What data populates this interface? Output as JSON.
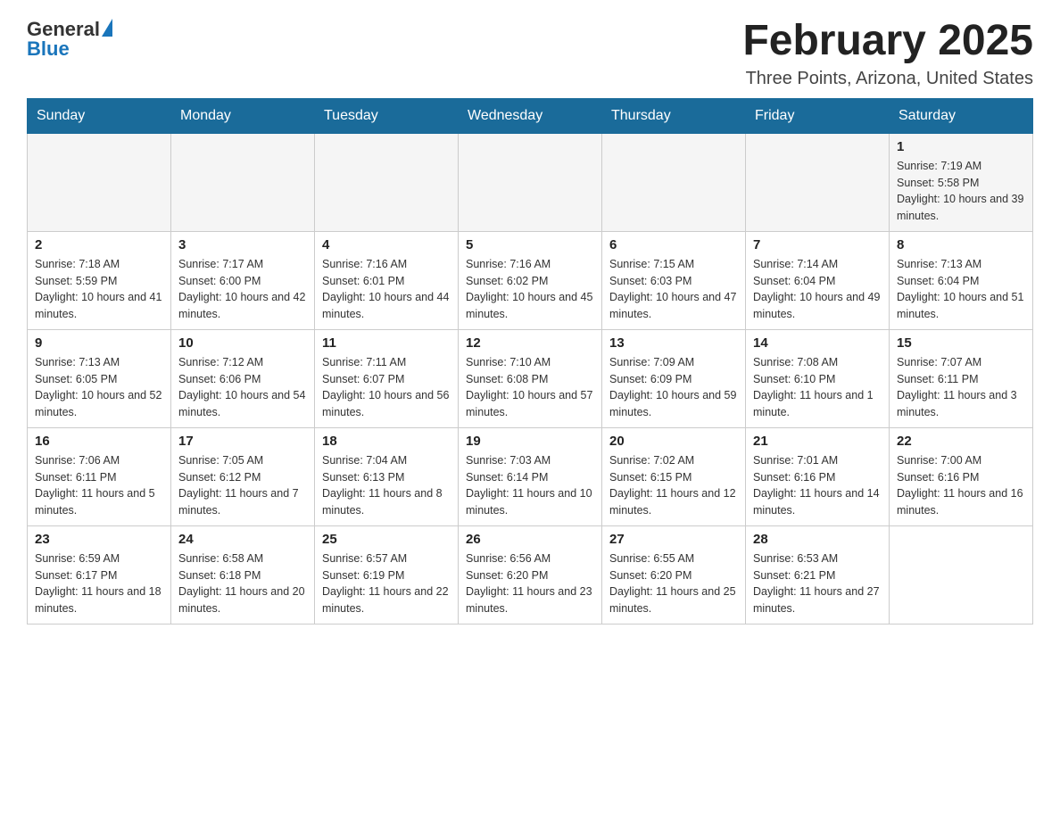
{
  "header": {
    "logo_general": "General",
    "logo_blue": "Blue",
    "month_title": "February 2025",
    "location": "Three Points, Arizona, United States"
  },
  "weekdays": [
    "Sunday",
    "Monday",
    "Tuesday",
    "Wednesday",
    "Thursday",
    "Friday",
    "Saturday"
  ],
  "weeks": [
    {
      "days": [
        {
          "num": "",
          "info": ""
        },
        {
          "num": "",
          "info": ""
        },
        {
          "num": "",
          "info": ""
        },
        {
          "num": "",
          "info": ""
        },
        {
          "num": "",
          "info": ""
        },
        {
          "num": "",
          "info": ""
        },
        {
          "num": "1",
          "info": "Sunrise: 7:19 AM\nSunset: 5:58 PM\nDaylight: 10 hours and 39 minutes."
        }
      ]
    },
    {
      "days": [
        {
          "num": "2",
          "info": "Sunrise: 7:18 AM\nSunset: 5:59 PM\nDaylight: 10 hours and 41 minutes."
        },
        {
          "num": "3",
          "info": "Sunrise: 7:17 AM\nSunset: 6:00 PM\nDaylight: 10 hours and 42 minutes."
        },
        {
          "num": "4",
          "info": "Sunrise: 7:16 AM\nSunset: 6:01 PM\nDaylight: 10 hours and 44 minutes."
        },
        {
          "num": "5",
          "info": "Sunrise: 7:16 AM\nSunset: 6:02 PM\nDaylight: 10 hours and 45 minutes."
        },
        {
          "num": "6",
          "info": "Sunrise: 7:15 AM\nSunset: 6:03 PM\nDaylight: 10 hours and 47 minutes."
        },
        {
          "num": "7",
          "info": "Sunrise: 7:14 AM\nSunset: 6:04 PM\nDaylight: 10 hours and 49 minutes."
        },
        {
          "num": "8",
          "info": "Sunrise: 7:13 AM\nSunset: 6:04 PM\nDaylight: 10 hours and 51 minutes."
        }
      ]
    },
    {
      "days": [
        {
          "num": "9",
          "info": "Sunrise: 7:13 AM\nSunset: 6:05 PM\nDaylight: 10 hours and 52 minutes."
        },
        {
          "num": "10",
          "info": "Sunrise: 7:12 AM\nSunset: 6:06 PM\nDaylight: 10 hours and 54 minutes."
        },
        {
          "num": "11",
          "info": "Sunrise: 7:11 AM\nSunset: 6:07 PM\nDaylight: 10 hours and 56 minutes."
        },
        {
          "num": "12",
          "info": "Sunrise: 7:10 AM\nSunset: 6:08 PM\nDaylight: 10 hours and 57 minutes."
        },
        {
          "num": "13",
          "info": "Sunrise: 7:09 AM\nSunset: 6:09 PM\nDaylight: 10 hours and 59 minutes."
        },
        {
          "num": "14",
          "info": "Sunrise: 7:08 AM\nSunset: 6:10 PM\nDaylight: 11 hours and 1 minute."
        },
        {
          "num": "15",
          "info": "Sunrise: 7:07 AM\nSunset: 6:11 PM\nDaylight: 11 hours and 3 minutes."
        }
      ]
    },
    {
      "days": [
        {
          "num": "16",
          "info": "Sunrise: 7:06 AM\nSunset: 6:11 PM\nDaylight: 11 hours and 5 minutes."
        },
        {
          "num": "17",
          "info": "Sunrise: 7:05 AM\nSunset: 6:12 PM\nDaylight: 11 hours and 7 minutes."
        },
        {
          "num": "18",
          "info": "Sunrise: 7:04 AM\nSunset: 6:13 PM\nDaylight: 11 hours and 8 minutes."
        },
        {
          "num": "19",
          "info": "Sunrise: 7:03 AM\nSunset: 6:14 PM\nDaylight: 11 hours and 10 minutes."
        },
        {
          "num": "20",
          "info": "Sunrise: 7:02 AM\nSunset: 6:15 PM\nDaylight: 11 hours and 12 minutes."
        },
        {
          "num": "21",
          "info": "Sunrise: 7:01 AM\nSunset: 6:16 PM\nDaylight: 11 hours and 14 minutes."
        },
        {
          "num": "22",
          "info": "Sunrise: 7:00 AM\nSunset: 6:16 PM\nDaylight: 11 hours and 16 minutes."
        }
      ]
    },
    {
      "days": [
        {
          "num": "23",
          "info": "Sunrise: 6:59 AM\nSunset: 6:17 PM\nDaylight: 11 hours and 18 minutes."
        },
        {
          "num": "24",
          "info": "Sunrise: 6:58 AM\nSunset: 6:18 PM\nDaylight: 11 hours and 20 minutes."
        },
        {
          "num": "25",
          "info": "Sunrise: 6:57 AM\nSunset: 6:19 PM\nDaylight: 11 hours and 22 minutes."
        },
        {
          "num": "26",
          "info": "Sunrise: 6:56 AM\nSunset: 6:20 PM\nDaylight: 11 hours and 23 minutes."
        },
        {
          "num": "27",
          "info": "Sunrise: 6:55 AM\nSunset: 6:20 PM\nDaylight: 11 hours and 25 minutes."
        },
        {
          "num": "28",
          "info": "Sunrise: 6:53 AM\nSunset: 6:21 PM\nDaylight: 11 hours and 27 minutes."
        },
        {
          "num": "",
          "info": ""
        }
      ]
    }
  ]
}
